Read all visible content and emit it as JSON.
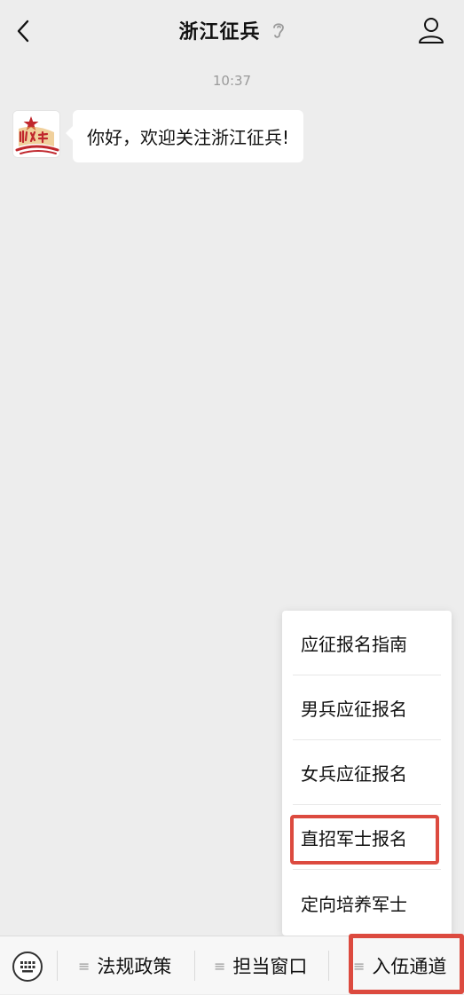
{
  "header": {
    "title": "浙江征兵",
    "icons": {
      "back": "chevron-left-icon",
      "voice": "ear-icon",
      "profile": "person-icon"
    }
  },
  "chat": {
    "timestamp": "10:37",
    "messages": [
      {
        "sender_avatar": "浙江征兵 logo",
        "text": "你好，欢迎关注浙江征兵!"
      }
    ]
  },
  "popup_menu": {
    "items": [
      {
        "label": "应征报名指南"
      },
      {
        "label": "男兵应征报名"
      },
      {
        "label": "女兵应征报名"
      },
      {
        "label": "直招军士报名",
        "highlighted": true
      },
      {
        "label": "定向培养军士"
      }
    ]
  },
  "bottom_menu": {
    "keyboard_icon": "keyboard-icon",
    "tabs": [
      {
        "label": "法规政策"
      },
      {
        "label": "担当窗口"
      },
      {
        "label": "入伍通道",
        "highlighted": true
      }
    ]
  },
  "colors": {
    "background": "#ededed",
    "highlight": "#dc4a3f",
    "logo_red": "#c0272d",
    "logo_gold": "#e3a94a"
  }
}
